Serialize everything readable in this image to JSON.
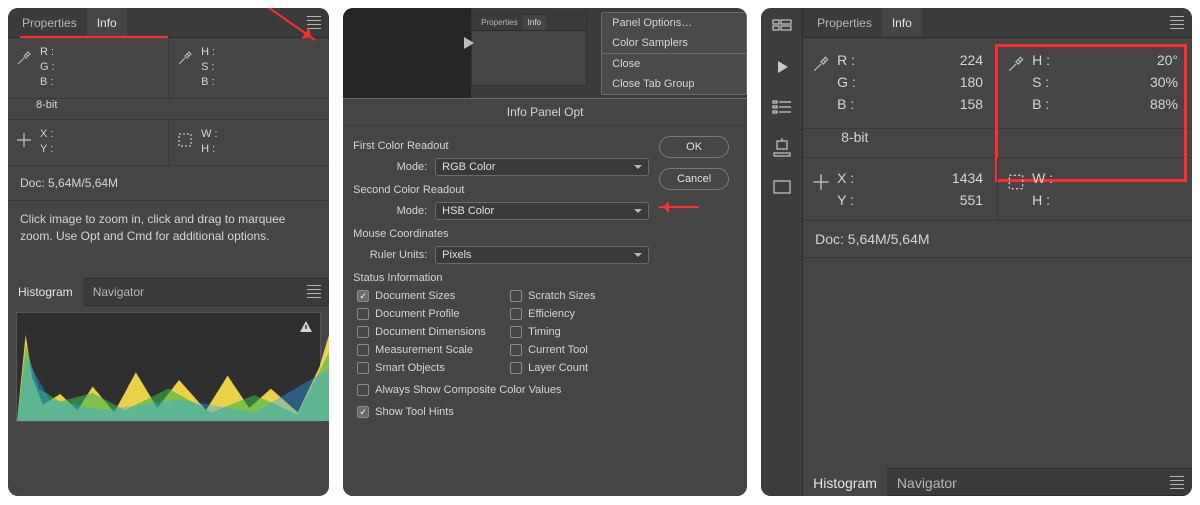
{
  "panel1": {
    "tabs": {
      "properties": "Properties",
      "info": "Info"
    },
    "color1": {
      "labels": [
        "R :",
        "G :",
        "B :"
      ],
      "values": [
        "",
        "",
        ""
      ]
    },
    "color2": {
      "labels": [
        "H :",
        "S :",
        "B :"
      ],
      "values": [
        "",
        "",
        ""
      ]
    },
    "bitDepth": "8-bit",
    "pos": {
      "labels": [
        "X :",
        "Y :"
      ],
      "values": [
        "",
        ""
      ]
    },
    "dims": {
      "labels": [
        "W :",
        "H :"
      ],
      "values": [
        "",
        ""
      ]
    },
    "docSize": "Doc: 5,64M/5,64M",
    "hint": "Click image to zoom in, click and drag to marquee zoom.  Use Opt and Cmd for additional options.",
    "tabs2": {
      "histogram": "Histogram",
      "navigator": "Navigator"
    }
  },
  "panel2": {
    "miniTabs": {
      "properties": "Properties",
      "info": "Info"
    },
    "menu": {
      "panelOptions": "Panel Options…",
      "colorSamplers": "Color Samplers",
      "close": "Close",
      "closeGroup": "Close Tab Group"
    },
    "dialog": {
      "title": "Info Panel Opt",
      "ok": "OK",
      "cancel": "Cancel",
      "firstReadout": "First Color Readout",
      "secondReadout": "Second Color Readout",
      "modeLabel": "Mode:",
      "mode1": "RGB Color",
      "mode2": "HSB Color",
      "mouseCoord": "Mouse Coordinates",
      "rulerLabel": "Ruler Units:",
      "rulerVal": "Pixels",
      "statusInfo": "Status Information",
      "checks": {
        "docSizes": "Document Sizes",
        "scratch": "Scratch Sizes",
        "docProfile": "Document Profile",
        "efficiency": "Efficiency",
        "docDims": "Document Dimensions",
        "timing": "Timing",
        "measure": "Measurement Scale",
        "curTool": "Current Tool",
        "smart": "Smart Objects",
        "layerCount": "Layer Count"
      },
      "alwaysComposite": "Always Show Composite Color Values",
      "showHints": "Show Tool Hints"
    }
  },
  "panel3": {
    "tabs": {
      "properties": "Properties",
      "info": "Info"
    },
    "color1": {
      "labels": [
        "R :",
        "G :",
        "B :"
      ],
      "values": [
        "224",
        "180",
        "158"
      ]
    },
    "color2": {
      "labels": [
        "H :",
        "S :",
        "B :"
      ],
      "values": [
        "20°",
        "30%",
        "88%"
      ]
    },
    "bitDepth": "8-bit",
    "pos": {
      "labels": [
        "X :",
        "Y :"
      ],
      "values": [
        "1434",
        "551"
      ]
    },
    "dims": {
      "labels": [
        "W :",
        "H :"
      ],
      "values": [
        "",
        ""
      ]
    },
    "docSize": "Doc: 5,64M/5,64M",
    "tabs2": {
      "histogram": "Histogram",
      "navigator": "Navigator"
    }
  }
}
